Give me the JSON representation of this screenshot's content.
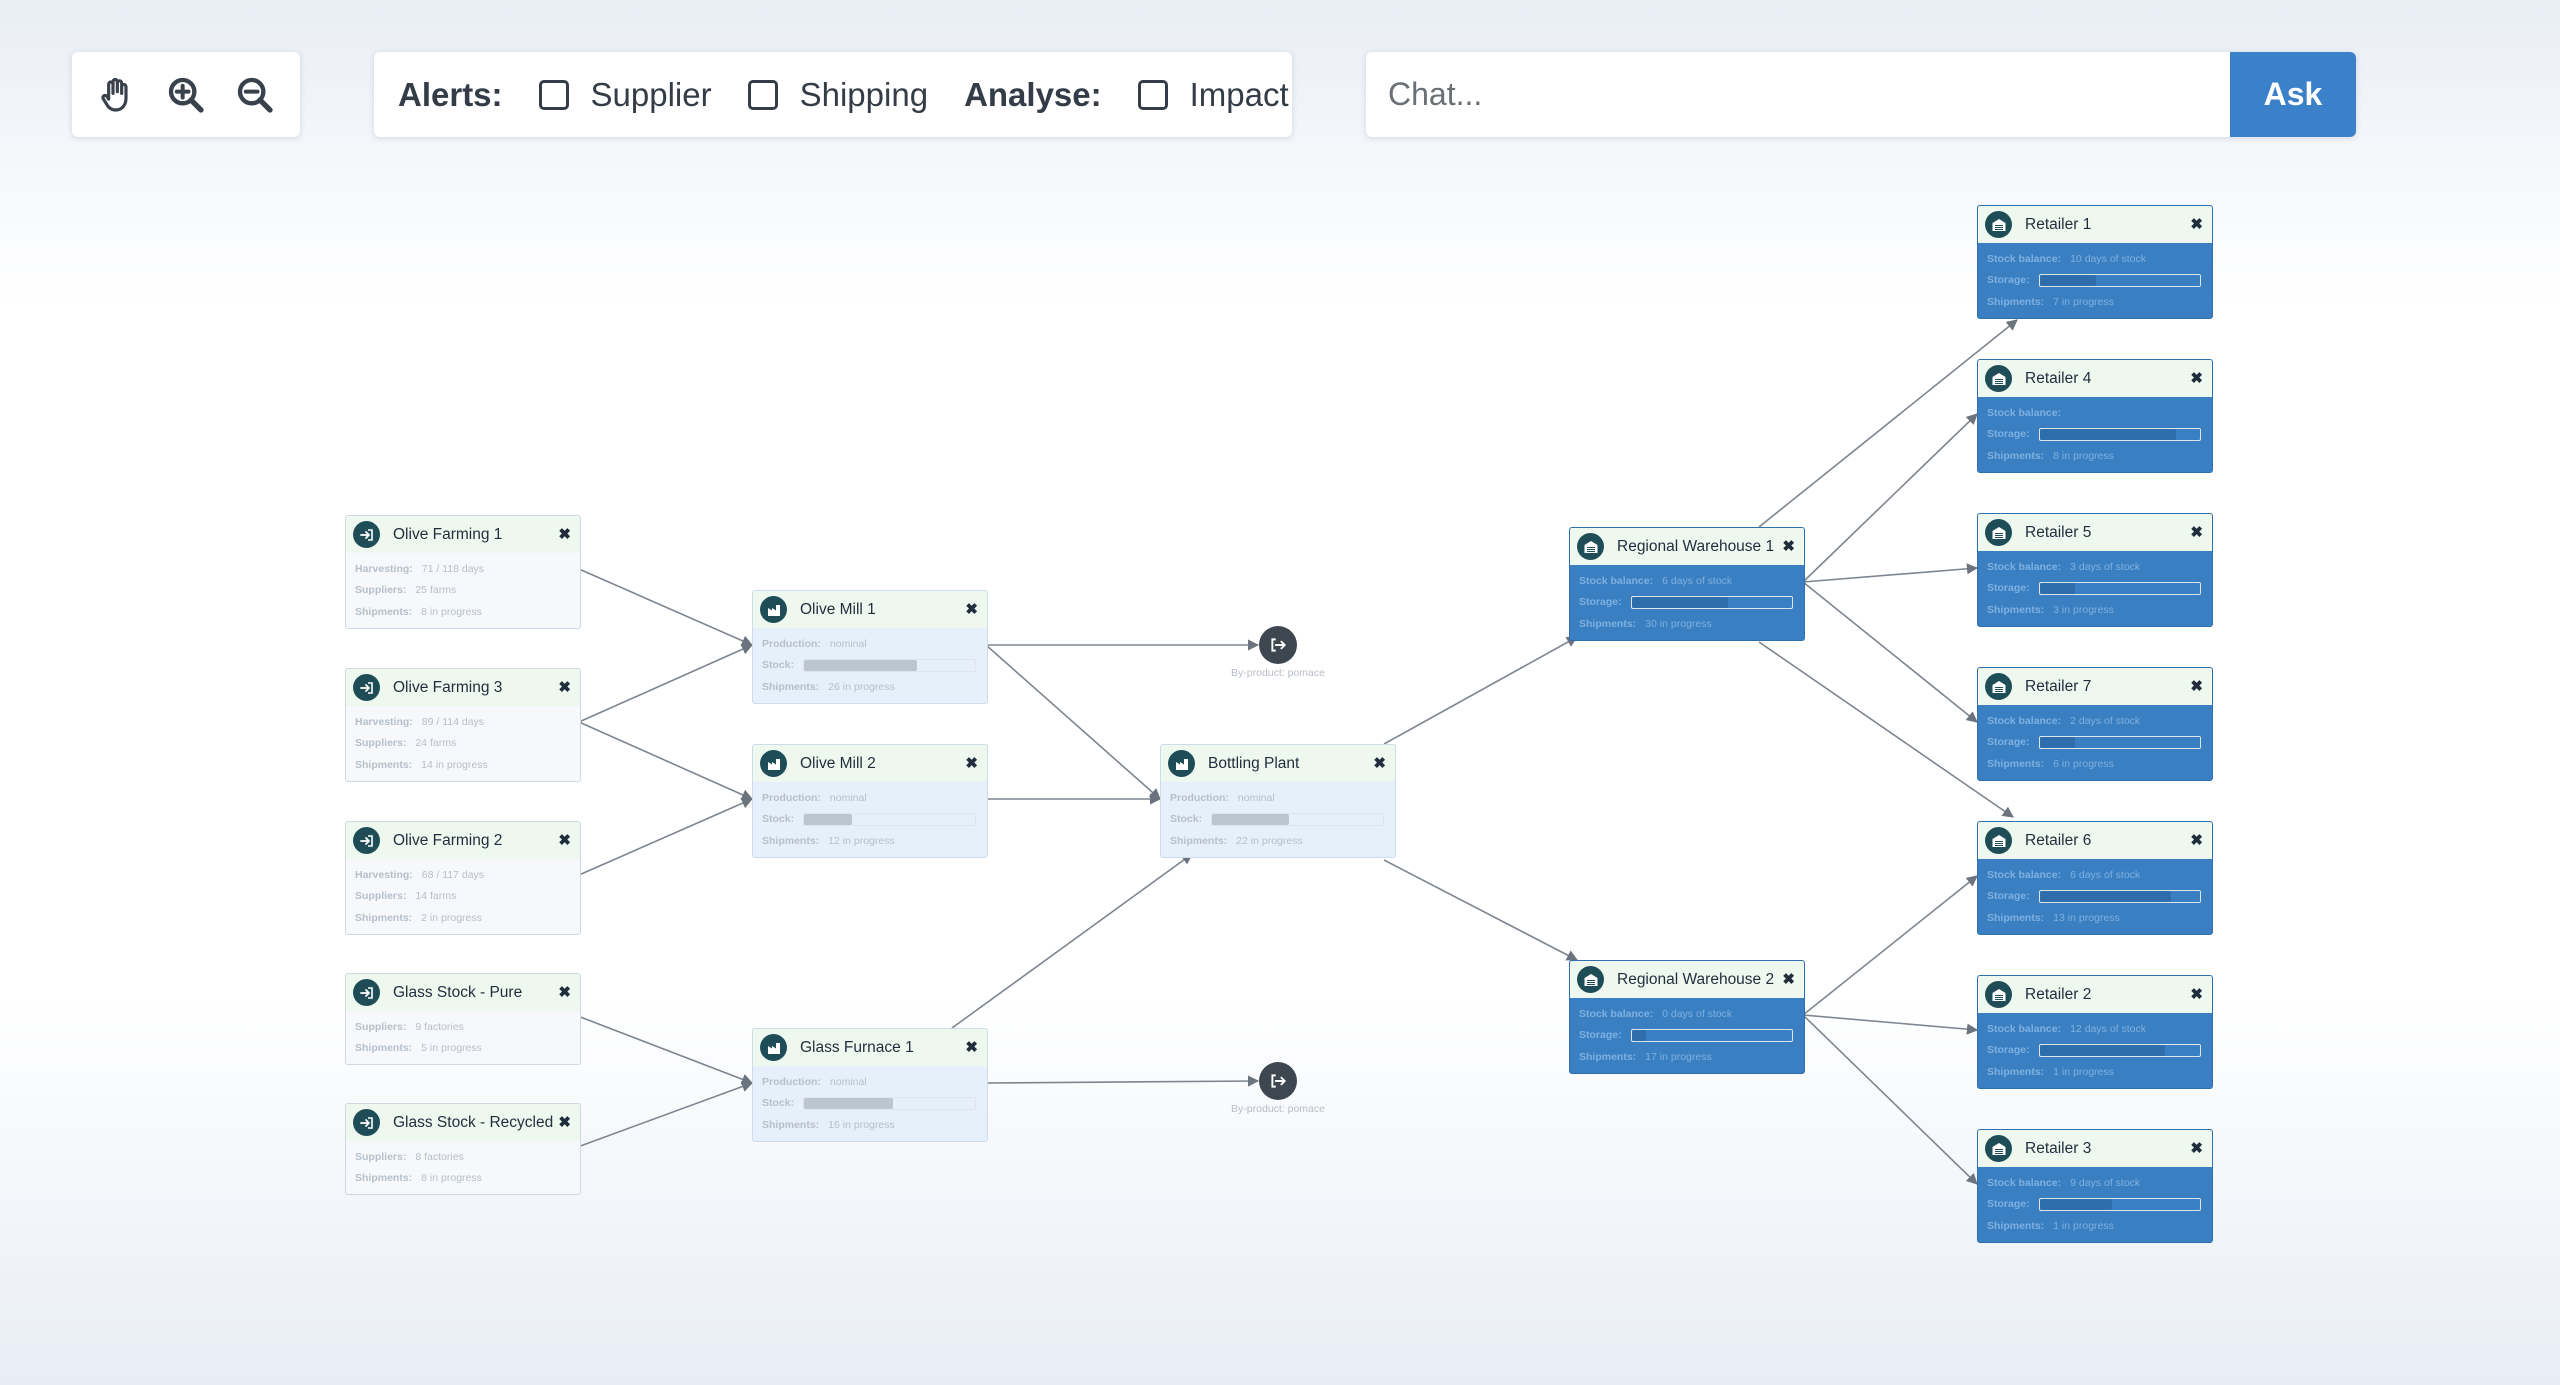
{
  "toolbar": {
    "tools": [
      {
        "name": "pan-icon"
      },
      {
        "name": "zoom-in-icon"
      },
      {
        "name": "zoom-out-icon"
      }
    ],
    "alerts_label": "Alerts:",
    "supplier_label": "Supplier",
    "shipping_label": "Shipping",
    "analyse_label": "Analyse:",
    "impact_label": "Impact"
  },
  "chat": {
    "placeholder": "Chat...",
    "ask_label": "Ask"
  },
  "colors": {
    "accent": "#3a81c9",
    "node_header": "#eef8ee",
    "icon": "#1e4d58",
    "distribution": "#3a7fc2"
  },
  "nodes": {
    "olive_farming_1": {
      "title": "Olive Farming 1",
      "harvesting_label": "Harvesting:",
      "harvesting": "71 / 118 days",
      "suppliers_label": "Suppliers:",
      "suppliers": "25 farms",
      "shipments_label": "Shipments:",
      "shipments": "8 in progress"
    },
    "olive_farming_3": {
      "title": "Olive Farming 3",
      "harvesting_label": "Harvesting:",
      "harvesting": "89 / 114 days",
      "suppliers_label": "Suppliers:",
      "suppliers": "24 farms",
      "shipments_label": "Shipments:",
      "shipments": "14 in progress"
    },
    "olive_farming_2": {
      "title": "Olive Farming 2",
      "harvesting_label": "Harvesting:",
      "harvesting": "68 / 117 days",
      "suppliers_label": "Suppliers:",
      "suppliers": "14 farms",
      "shipments_label": "Shipments:",
      "shipments": "2 in progress"
    },
    "glass_stock_pure": {
      "title": "Glass Stock - Pure",
      "suppliers_label": "Suppliers:",
      "suppliers": "9 factories",
      "shipments_label": "Shipments:",
      "shipments": "5 in progress"
    },
    "glass_stock_recycled": {
      "title": "Glass Stock - Recycled",
      "suppliers_label": "Suppliers:",
      "suppliers": "8 factories",
      "shipments_label": "Shipments:",
      "shipments": "8 in progress"
    },
    "olive_mill_1": {
      "title": "Olive Mill 1",
      "production_label": "Production:",
      "production": "nominal",
      "stock_label": "Stock:",
      "stock_level": 0.66,
      "shipments_label": "Shipments:",
      "shipments": "26 in progress"
    },
    "olive_mill_2": {
      "title": "Olive Mill 2",
      "production_label": "Production:",
      "production": "nominal",
      "stock_label": "Stock:",
      "stock_level": 0.28,
      "shipments_label": "Shipments:",
      "shipments": "12 in progress"
    },
    "glass_furnace_1": {
      "title": "Glass Furnace 1",
      "production_label": "Production:",
      "production": "nominal",
      "stock_label": "Stock:",
      "stock_level": 0.52,
      "shipments_label": "Shipments:",
      "shipments": "16 in progress"
    },
    "bottling_plant": {
      "title": "Bottling Plant",
      "production_label": "Production:",
      "production": "nominal",
      "stock_label": "Stock:",
      "stock_level": 0.45,
      "shipments_label": "Shipments:",
      "shipments": "22 in progress"
    },
    "regional_warehouse_1": {
      "title": "Regional Warehouse 1",
      "stock_balance_label": "Stock balance:",
      "stock_balance": "6 days of stock",
      "storage_label": "Storage:",
      "storage_level": 0.6,
      "shipments_label": "Shipments:",
      "shipments": "30 in progress"
    },
    "regional_warehouse_2": {
      "title": "Regional Warehouse 2",
      "stock_balance_label": "Stock balance:",
      "stock_balance": "0 days of stock",
      "storage_label": "Storage:",
      "storage_level": 0.09,
      "shipments_label": "Shipments:",
      "shipments": "17 in progress"
    },
    "retailer_1": {
      "title": "Retailer 1",
      "stock_balance_label": "Stock balance:",
      "stock_balance": "10 days of stock",
      "storage_label": "Storage:",
      "storage_level": 0.35,
      "shipments_label": "Shipments:",
      "shipments": "7 in progress"
    },
    "retailer_4": {
      "title": "Retailer 4",
      "stock_balance_label": "Stock balance:",
      "stock_balance": "",
      "storage_label": "Storage:",
      "storage_level": 0.85,
      "shipments_label": "Shipments:",
      "shipments": "8 in progress"
    },
    "retailer_5": {
      "title": "Retailer 5",
      "stock_balance_label": "Stock balance:",
      "stock_balance": "3 days of stock",
      "storage_label": "Storage:",
      "storage_level": 0.22,
      "shipments_label": "Shipments:",
      "shipments": "3 in progress"
    },
    "retailer_7": {
      "title": "Retailer 7",
      "stock_balance_label": "Stock balance:",
      "stock_balance": "2 days of stock",
      "storage_label": "Storage:",
      "storage_level": 0.22,
      "shipments_label": "Shipments:",
      "shipments": "6 in progress"
    },
    "retailer_6": {
      "title": "Retailer 6",
      "stock_balance_label": "Stock balance:",
      "stock_balance": "6 days of stock",
      "storage_label": "Storage:",
      "storage_level": 0.82,
      "shipments_label": "Shipments:",
      "shipments": "13 in progress"
    },
    "retailer_2": {
      "title": "Retailer 2",
      "stock_balance_label": "Stock balance:",
      "stock_balance": "12 days of stock",
      "storage_label": "Storage:",
      "storage_level": 0.78,
      "shipments_label": "Shipments:",
      "shipments": "1 in progress"
    },
    "retailer_3": {
      "title": "Retailer 3",
      "stock_balance_label": "Stock balance:",
      "stock_balance": "9 days of stock",
      "storage_label": "Storage:",
      "storage_level": 0.45,
      "shipments_label": "Shipments:",
      "shipments": "1 in progress"
    }
  },
  "byproducts": [
    {
      "label": "By-product: pomace"
    },
    {
      "label": "By-product: pomace"
    }
  ],
  "edges": [
    [
      "olive_farming_1",
      "olive_mill_1"
    ],
    [
      "olive_farming_3",
      "olive_mill_1"
    ],
    [
      "olive_farming_3",
      "olive_mill_2"
    ],
    [
      "olive_farming_2",
      "olive_mill_2"
    ],
    [
      "glass_stock_pure",
      "glass_furnace_1"
    ],
    [
      "glass_stock_recycled",
      "glass_furnace_1"
    ],
    [
      "olive_mill_1",
      "byproduct_1"
    ],
    [
      "olive_mill_1",
      "bottling_plant"
    ],
    [
      "olive_mill_2",
      "bottling_plant"
    ],
    [
      "glass_furnace_1",
      "bottling_plant"
    ],
    [
      "glass_furnace_1",
      "byproduct_2"
    ],
    [
      "bottling_plant",
      "regional_warehouse_1"
    ],
    [
      "bottling_plant",
      "regional_warehouse_2"
    ],
    [
      "regional_warehouse_1",
      "retailer_1"
    ],
    [
      "regional_warehouse_1",
      "retailer_4"
    ],
    [
      "regional_warehouse_1",
      "retailer_5"
    ],
    [
      "regional_warehouse_1",
      "retailer_7"
    ],
    [
      "regional_warehouse_1",
      "retailer_6"
    ],
    [
      "regional_warehouse_2",
      "retailer_6"
    ],
    [
      "regional_warehouse_2",
      "retailer_2"
    ],
    [
      "regional_warehouse_2",
      "retailer_3"
    ]
  ]
}
